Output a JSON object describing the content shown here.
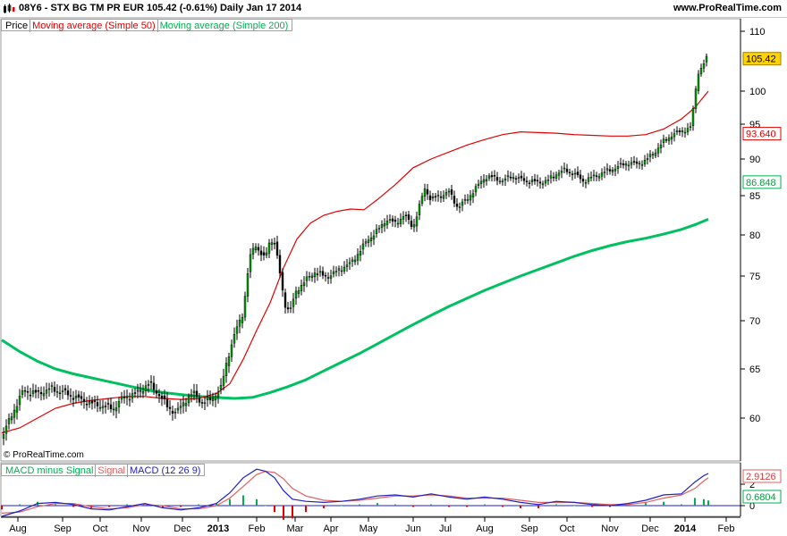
{
  "header": {
    "symbol_line": "08Y6 - STX BG TM PR EUR   105.42 (-0.61%)   Daily  Jan 17 2014",
    "site": "www.ProRealTime.com"
  },
  "price_legend": [
    {
      "label": "Price",
      "color": "#000000"
    },
    {
      "label": "Moving average (Simple 50)",
      "color": "#e00000"
    },
    {
      "label": "Moving average (Simple 200)",
      "color": "#00b050"
    }
  ],
  "macd_legend": [
    {
      "label": "MACD minus Signal",
      "color": "#00b050"
    },
    {
      "label": "Signal",
      "color": "#e06060"
    },
    {
      "label": "MACD (12 26 9)",
      "color": "#2020c0"
    }
  ],
  "watermark": "© ProRealTime.com",
  "chart_data": [
    {
      "type": "line",
      "name": "price-panel",
      "x_tick_labels": [
        "Aug",
        "Sep",
        "Oct",
        "Nov",
        "Dec",
        "2013",
        "Feb",
        "Mar",
        "Apr",
        "May",
        "Jun",
        "Jul",
        "Aug",
        "Sep",
        "Oct",
        "Nov",
        "Dec",
        "2014",
        "Feb"
      ],
      "y_tick_labels": [
        "60",
        "65",
        "70",
        "75",
        "80",
        "85",
        "90",
        "95",
        "100",
        "110"
      ],
      "ylim": [
        57,
        111
      ],
      "grid": false,
      "last_price_label": "105.42",
      "ma50_label": "93.640",
      "ma200_label": "86.848",
      "colors": {
        "price": "#000000",
        "up": "#00a000",
        "ma50": "#e00000",
        "ma200": "#00c060",
        "last_bg": "#ffd200"
      },
      "price_points": [
        [
          0,
          58
        ],
        [
          12,
          60.5
        ],
        [
          24,
          62.8
        ],
        [
          40,
          62.5
        ],
        [
          55,
          63
        ],
        [
          70,
          62.6
        ],
        [
          85,
          62
        ],
        [
          100,
          61.5
        ],
        [
          115,
          61.2
        ],
        [
          125,
          61
        ],
        [
          135,
          62
        ],
        [
          150,
          62.5
        ],
        [
          165,
          63.5
        ],
        [
          175,
          62.5
        ],
        [
          185,
          61.2
        ],
        [
          195,
          60.5
        ],
        [
          205,
          61.8
        ],
        [
          215,
          62.5
        ],
        [
          225,
          61.5
        ],
        [
          235,
          62
        ],
        [
          245,
          63
        ],
        [
          252,
          66
        ],
        [
          262,
          69
        ],
        [
          270,
          71
        ],
        [
          277,
          77
        ],
        [
          283,
          79
        ],
        [
          288,
          78
        ],
        [
          294,
          77
        ],
        [
          300,
          79.5
        ],
        [
          305,
          79
        ],
        [
          310,
          76
        ],
        [
          316,
          72
        ],
        [
          322,
          71
        ],
        [
          330,
          73.5
        ],
        [
          340,
          74.5
        ],
        [
          350,
          75.5
        ],
        [
          360,
          75
        ],
        [
          370,
          75.2
        ],
        [
          380,
          76
        ],
        [
          390,
          76.5
        ],
        [
          400,
          78
        ],
        [
          410,
          79.5
        ],
        [
          420,
          80.5
        ],
        [
          430,
          82
        ],
        [
          440,
          81.5
        ],
        [
          450,
          82.5
        ],
        [
          460,
          81
        ],
        [
          468,
          84
        ],
        [
          473,
          86
        ],
        [
          480,
          84.5
        ],
        [
          490,
          85
        ],
        [
          500,
          85.5
        ],
        [
          510,
          83.5
        ],
        [
          520,
          84.5
        ],
        [
          530,
          86
        ],
        [
          540,
          87.5
        ],
        [
          550,
          87.5
        ],
        [
          560,
          87
        ],
        [
          570,
          87.7
        ],
        [
          580,
          87.2
        ],
        [
          590,
          87
        ],
        [
          600,
          86.8
        ],
        [
          610,
          87
        ],
        [
          620,
          88
        ],
        [
          630,
          88.5
        ],
        [
          640,
          88
        ],
        [
          650,
          87
        ],
        [
          660,
          87.5
        ],
        [
          670,
          88
        ],
        [
          680,
          88.5
        ],
        [
          690,
          89
        ],
        [
          700,
          89.5
        ],
        [
          710,
          89.3
        ],
        [
          720,
          89.8
        ],
        [
          730,
          91
        ],
        [
          740,
          92.5
        ],
        [
          750,
          93.5
        ],
        [
          760,
          94
        ],
        [
          770,
          94.5
        ],
        [
          775,
          99
        ],
        [
          778,
          103
        ],
        [
          783,
          104
        ],
        [
          788,
          105.5
        ],
        [
          791,
          106.5
        ]
      ],
      "ma50_points": [
        [
          0,
          58.5
        ],
        [
          20,
          59
        ],
        [
          40,
          60
        ],
        [
          60,
          61
        ],
        [
          80,
          61.5
        ],
        [
          100,
          61.8
        ],
        [
          120,
          62
        ],
        [
          140,
          62.2
        ],
        [
          160,
          62.2
        ],
        [
          180,
          62
        ],
        [
          200,
          61.9
        ],
        [
          220,
          62
        ],
        [
          240,
          62.5
        ],
        [
          255,
          63.5
        ],
        [
          270,
          66
        ],
        [
          285,
          69
        ],
        [
          300,
          72
        ],
        [
          315,
          76
        ],
        [
          330,
          79.5
        ],
        [
          345,
          81.5
        ],
        [
          360,
          82.5
        ],
        [
          375,
          83
        ],
        [
          390,
          83.3
        ],
        [
          405,
          83.2
        ],
        [
          420,
          84.5
        ],
        [
          440,
          86.5
        ],
        [
          460,
          88.8
        ],
        [
          480,
          90
        ],
        [
          500,
          91
        ],
        [
          520,
          92
        ],
        [
          540,
          92.8
        ],
        [
          560,
          93.5
        ],
        [
          580,
          93.9
        ],
        [
          600,
          93.8
        ],
        [
          620,
          93.7
        ],
        [
          640,
          93.5
        ],
        [
          660,
          93.4
        ],
        [
          680,
          93.3
        ],
        [
          700,
          93.3
        ],
        [
          720,
          93.5
        ],
        [
          740,
          94.3
        ],
        [
          760,
          95.8
        ],
        [
          775,
          97.5
        ],
        [
          790,
          100
        ]
      ],
      "ma200_points": [
        [
          0,
          68
        ],
        [
          20,
          66.8
        ],
        [
          40,
          65.8
        ],
        [
          60,
          65
        ],
        [
          80,
          64.5
        ],
        [
          100,
          64.1
        ],
        [
          120,
          63.7
        ],
        [
          140,
          63.3
        ],
        [
          160,
          62.9
        ],
        [
          180,
          62.6
        ],
        [
          200,
          62.4
        ],
        [
          220,
          62.2
        ],
        [
          240,
          62.1
        ],
        [
          260,
          62
        ],
        [
          280,
          62.1
        ],
        [
          300,
          62.6
        ],
        [
          320,
          63.2
        ],
        [
          340,
          63.9
        ],
        [
          360,
          64.8
        ],
        [
          380,
          65.7
        ],
        [
          400,
          66.6
        ],
        [
          420,
          67.6
        ],
        [
          440,
          68.6
        ],
        [
          460,
          69.6
        ],
        [
          480,
          70.6
        ],
        [
          500,
          71.6
        ],
        [
          520,
          72.5
        ],
        [
          540,
          73.4
        ],
        [
          560,
          74.2
        ],
        [
          580,
          75
        ],
        [
          600,
          75.8
        ],
        [
          620,
          76.6
        ],
        [
          640,
          77.4
        ],
        [
          660,
          78.1
        ],
        [
          680,
          78.7
        ],
        [
          700,
          79.2
        ],
        [
          720,
          79.6
        ],
        [
          740,
          80.1
        ],
        [
          760,
          80.7
        ],
        [
          775,
          81.3
        ],
        [
          790,
          82
        ]
      ]
    },
    {
      "type": "line",
      "name": "macd-panel",
      "y_tick_labels": [
        "0",
        "2"
      ],
      "macd_label": "2.9126",
      "signal_label": "0.6804",
      "colors": {
        "macd": "#2020c0",
        "signal": "#e06060",
        "hist": "#00b050",
        "hist_neg": "#e00000"
      },
      "macd_points": [
        [
          0,
          -1
        ],
        [
          20,
          -0.5
        ],
        [
          40,
          0.2
        ],
        [
          60,
          0.3
        ],
        [
          80,
          0.1
        ],
        [
          100,
          -0.3
        ],
        [
          120,
          -0.4
        ],
        [
          140,
          -0.1
        ],
        [
          160,
          0.2
        ],
        [
          180,
          -0.2
        ],
        [
          200,
          -0.4
        ],
        [
          220,
          -0.2
        ],
        [
          240,
          0.2
        ],
        [
          255,
          1.2
        ],
        [
          270,
          2.6
        ],
        [
          285,
          3.4
        ],
        [
          295,
          3.2
        ],
        [
          305,
          2.6
        ],
        [
          315,
          1.4
        ],
        [
          325,
          0.6
        ],
        [
          340,
          0.4
        ],
        [
          360,
          0.3
        ],
        [
          380,
          0.4
        ],
        [
          400,
          0.6
        ],
        [
          420,
          0.9
        ],
        [
          440,
          1
        ],
        [
          460,
          0.8
        ],
        [
          480,
          1.1
        ],
        [
          500,
          0.8
        ],
        [
          520,
          0.6
        ],
        [
          540,
          0.8
        ],
        [
          560,
          0.6
        ],
        [
          580,
          0.3
        ],
        [
          600,
          0.1
        ],
        [
          620,
          0.4
        ],
        [
          640,
          0.3
        ],
        [
          660,
          0.1
        ],
        [
          680,
          0
        ],
        [
          700,
          0.2
        ],
        [
          720,
          0.5
        ],
        [
          740,
          1
        ],
        [
          760,
          1.1
        ],
        [
          775,
          2.2
        ],
        [
          785,
          2.8
        ],
        [
          790,
          3
        ]
      ],
      "signal_points": [
        [
          0,
          -0.7
        ],
        [
          20,
          -0.6
        ],
        [
          40,
          -0.1
        ],
        [
          60,
          0.2
        ],
        [
          80,
          0.2
        ],
        [
          100,
          -0.1
        ],
        [
          120,
          -0.3
        ],
        [
          140,
          -0.2
        ],
        [
          160,
          0.1
        ],
        [
          180,
          0
        ],
        [
          200,
          -0.3
        ],
        [
          220,
          -0.3
        ],
        [
          240,
          0
        ],
        [
          255,
          0.7
        ],
        [
          270,
          1.8
        ],
        [
          285,
          2.9
        ],
        [
          295,
          3.2
        ],
        [
          305,
          3.1
        ],
        [
          315,
          2.5
        ],
        [
          325,
          1.6
        ],
        [
          340,
          0.9
        ],
        [
          360,
          0.5
        ],
        [
          380,
          0.4
        ],
        [
          400,
          0.5
        ],
        [
          420,
          0.7
        ],
        [
          440,
          0.9
        ],
        [
          460,
          0.9
        ],
        [
          480,
          1
        ],
        [
          500,
          0.9
        ],
        [
          520,
          0.7
        ],
        [
          540,
          0.7
        ],
        [
          560,
          0.7
        ],
        [
          580,
          0.5
        ],
        [
          600,
          0.3
        ],
        [
          620,
          0.3
        ],
        [
          640,
          0.3
        ],
        [
          660,
          0.2
        ],
        [
          680,
          0.1
        ],
        [
          700,
          0.1
        ],
        [
          720,
          0.3
        ],
        [
          740,
          0.7
        ],
        [
          760,
          1
        ],
        [
          775,
          1.6
        ],
        [
          785,
          2.3
        ],
        [
          790,
          2.6
        ]
      ]
    }
  ]
}
